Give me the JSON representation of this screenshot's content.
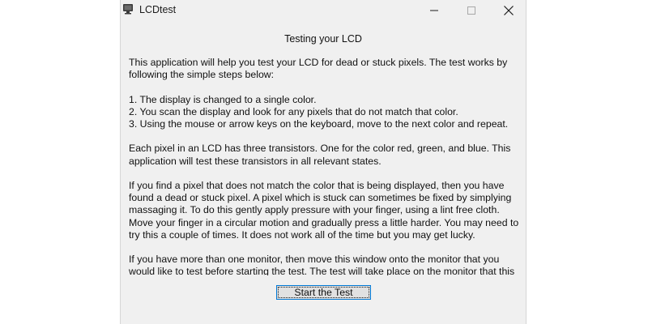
{
  "window": {
    "title": "LCDtest"
  },
  "controls": {
    "minimize_icon": "minimize-icon",
    "maximize_icon": "maximize-icon",
    "close_icon": "close-icon"
  },
  "heading": "Testing your LCD",
  "paragraphs": [
    "This application will help you test your LCD for dead or stuck pixels.  The test works by following the simple steps below:",
    "1. The display is changed to a single color.",
    "2. You scan the display and look for any pixels that do not match that color.",
    "3. Using the mouse or arrow keys on the keyboard, move to the next color and repeat.",
    "Each pixel in an LCD has three transistors.  One for the color red, green, and blue.  This application will test these transistors in all relevant states.",
    "If you find a pixel that does not match the color that is being displayed, then you have found a dead or stuck pixel.  A pixel which is stuck can sometimes be fixed by simplying massaging it.  To do this gently apply pressure with your finger, using a lint free cloth.  Move your finger in a circular motion and gradually press a little harder.  You may need to try this a couple of times.  It does not work all of the time but you may get lucky.",
    "If you have more than one monitor, then move this window onto the monitor that you would like to test before starting the test.  The test will take place on the monitor that this"
  ],
  "start_button_label": "Start the Test",
  "colors": {
    "window_bg": "#f0f0f0",
    "button_bg": "#e1e1e1",
    "button_border": "#0078d4"
  }
}
